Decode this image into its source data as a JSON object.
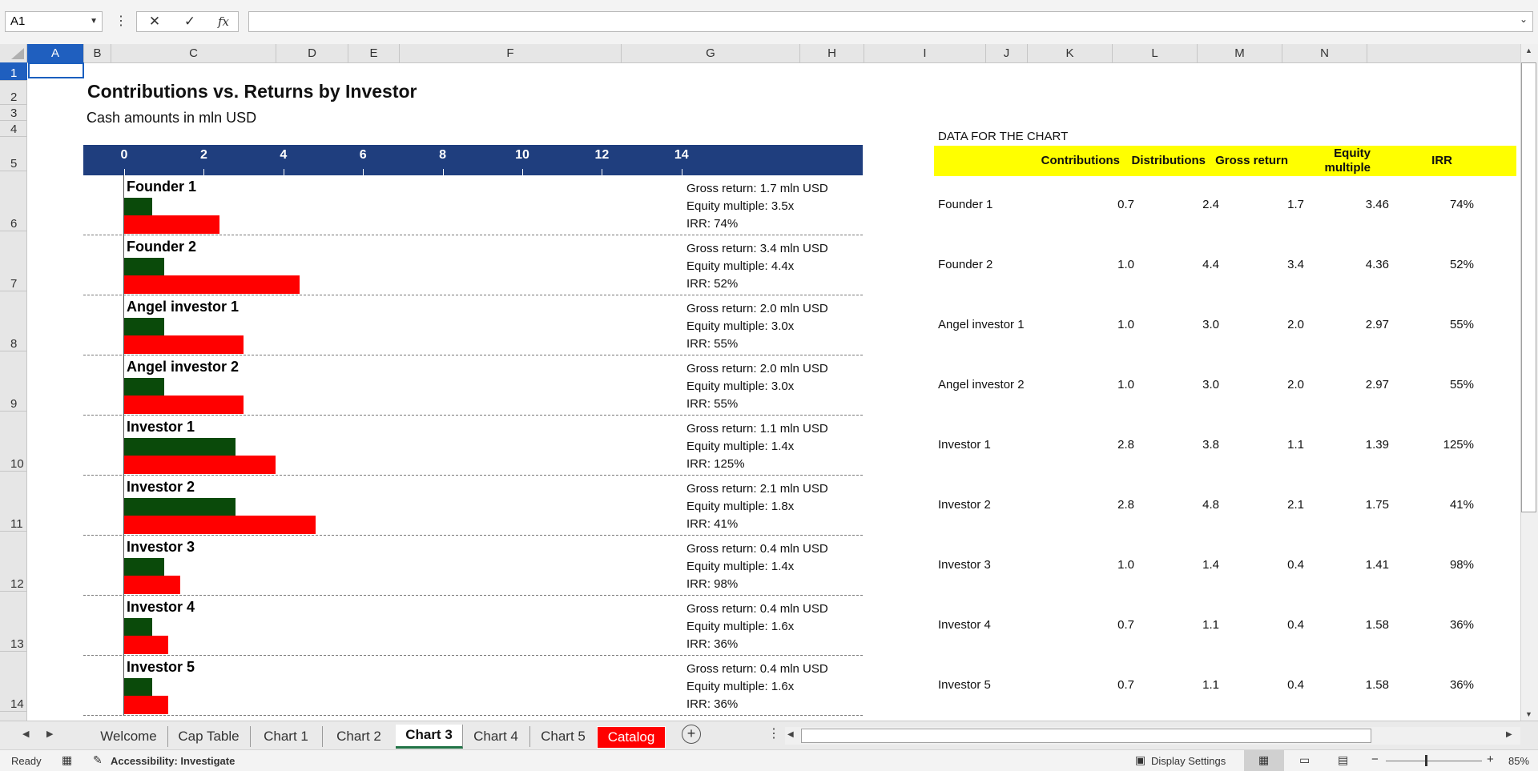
{
  "formula_bar": {
    "name_box": "A1",
    "cancel_icon": "✕",
    "enter_icon": "✓",
    "fx_label": "fx",
    "formula_value": ""
  },
  "columns": [
    "A",
    "B",
    "C",
    "D",
    "E",
    "F",
    "G",
    "H",
    "I",
    "J",
    "K",
    "L",
    "M",
    "N"
  ],
  "rows": [
    "1",
    "2",
    "3",
    "4",
    "5",
    "6",
    "7",
    "8",
    "9",
    "10",
    "11",
    "12",
    "13",
    "14"
  ],
  "sheet": {
    "title": "Contributions vs. Returns by Investor",
    "subtitle": "Cash amounts in mln USD",
    "data_title": "DATA FOR THE CHART"
  },
  "chart_data": {
    "type": "bar",
    "orientation": "horizontal",
    "xlim": [
      0,
      14
    ],
    "ticks": [
      "0",
      "2",
      "4",
      "6",
      "8",
      "10",
      "12",
      "14"
    ],
    "categories": [
      "Founder 1",
      "Founder 2",
      "Angel investor 1",
      "Angel investor 2",
      "Investor 1",
      "Investor 2",
      "Investor 3",
      "Investor 4",
      "Investor 5"
    ],
    "series": [
      {
        "name": "Contributions",
        "color": "#0a4a0a",
        "values": [
          0.7,
          1.0,
          1.0,
          1.0,
          2.8,
          2.8,
          1.0,
          0.7,
          0.7
        ]
      },
      {
        "name": "Distributions",
        "color": "#ff0000",
        "values": [
          2.4,
          4.4,
          3.0,
          3.0,
          3.8,
          4.8,
          1.4,
          1.1,
          1.1
        ]
      }
    ],
    "annotations": [
      [
        "Gross return: 1.7 mln USD",
        "Equity multiple: 3.5x",
        "IRR: 74%"
      ],
      [
        "Gross return: 3.4 mln USD",
        "Equity multiple: 4.4x",
        "IRR: 52%"
      ],
      [
        "Gross return: 2.0 mln USD",
        "Equity multiple: 3.0x",
        "IRR: 55%"
      ],
      [
        "Gross return: 2.0 mln USD",
        "Equity multiple: 3.0x",
        "IRR: 55%"
      ],
      [
        "Gross return: 1.1 mln USD",
        "Equity multiple: 1.4x",
        "IRR: 125%"
      ],
      [
        "Gross return: 2.1 mln USD",
        "Equity multiple: 1.8x",
        "IRR: 41%"
      ],
      [
        "Gross return: 0.4 mln USD",
        "Equity multiple: 1.4x",
        "IRR: 98%"
      ],
      [
        "Gross return: 0.4 mln USD",
        "Equity multiple: 1.6x",
        "IRR: 36%"
      ],
      [
        "Gross return: 0.4 mln USD",
        "Equity multiple: 1.6x",
        "IRR: 36%"
      ]
    ]
  },
  "table": {
    "headers": [
      "Contributions",
      "Distributions",
      "Gross return",
      "Equity multiple",
      "IRR"
    ],
    "rows": [
      {
        "name": "Founder 1",
        "values": [
          "0.7",
          "2.4",
          "1.7",
          "3.46",
          "74%"
        ]
      },
      {
        "name": "Founder 2",
        "values": [
          "1.0",
          "4.4",
          "3.4",
          "4.36",
          "52%"
        ]
      },
      {
        "name": "Angel investor 1",
        "values": [
          "1.0",
          "3.0",
          "2.0",
          "2.97",
          "55%"
        ]
      },
      {
        "name": "Angel investor 2",
        "values": [
          "1.0",
          "3.0",
          "2.0",
          "2.97",
          "55%"
        ]
      },
      {
        "name": "Investor 1",
        "values": [
          "2.8",
          "3.8",
          "1.1",
          "1.39",
          "125%"
        ]
      },
      {
        "name": "Investor 2",
        "values": [
          "2.8",
          "4.8",
          "2.1",
          "1.75",
          "41%"
        ]
      },
      {
        "name": "Investor 3",
        "values": [
          "1.0",
          "1.4",
          "0.4",
          "1.41",
          "98%"
        ]
      },
      {
        "name": "Investor 4",
        "values": [
          "0.7",
          "1.1",
          "0.4",
          "1.58",
          "36%"
        ]
      },
      {
        "name": "Investor 5",
        "values": [
          "0.7",
          "1.1",
          "0.4",
          "1.58",
          "36%"
        ]
      }
    ]
  },
  "tabs": [
    {
      "label": "Welcome"
    },
    {
      "label": "Cap Table"
    },
    {
      "label": "Chart 1"
    },
    {
      "label": "Chart 2"
    },
    {
      "label": "Chart 3",
      "active": true
    },
    {
      "label": "Chart 4"
    },
    {
      "label": "Chart 5"
    },
    {
      "label": "Catalog",
      "color": "#ff0000"
    }
  ],
  "status": {
    "ready": "Ready",
    "accessibility": "Accessibility: Investigate",
    "display_settings": "Display Settings",
    "zoom": "85%"
  }
}
